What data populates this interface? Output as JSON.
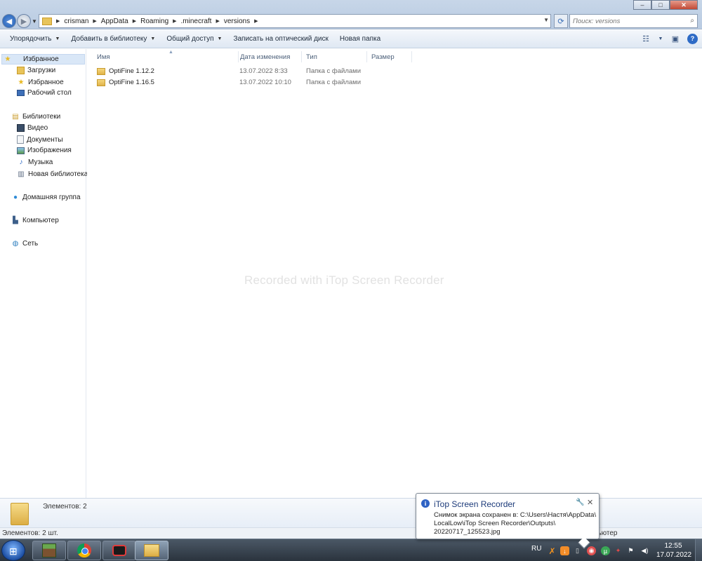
{
  "window": {
    "breadcrumbs": [
      "crisman",
      "AppData",
      "Roaming",
      ".minecraft",
      "versions"
    ],
    "search_placeholder": "Поиск: versions",
    "controls": {
      "minimize": "–",
      "maximize": "□",
      "close": "✕"
    }
  },
  "toolbar": {
    "items": [
      {
        "label": "Упорядочить",
        "has_arrow": true
      },
      {
        "label": "Добавить в библиотеку",
        "has_arrow": true
      },
      {
        "label": "Общий доступ",
        "has_arrow": true
      },
      {
        "label": "Записать на оптический диск",
        "has_arrow": false
      },
      {
        "label": "Новая папка",
        "has_arrow": false
      }
    ],
    "arrow_glyph": "▼"
  },
  "navpane": {
    "favorites": {
      "label": "Избранное",
      "icon": "star-icon"
    },
    "favorite_items": [
      {
        "label": "Загрузки",
        "icon": "downloads-folder-icon"
      },
      {
        "label": "Избранное",
        "icon": "star-icon"
      },
      {
        "label": "Рабочий стол",
        "icon": "desktop-icon"
      }
    ],
    "libraries": {
      "label": "Библиотеки",
      "icon": "libraries-icon"
    },
    "library_items": [
      {
        "label": "Видео",
        "icon": "video-icon"
      },
      {
        "label": "Документы",
        "icon": "documents-icon"
      },
      {
        "label": "Изображения",
        "icon": "pictures-icon"
      },
      {
        "label": "Музыка",
        "icon": "music-icon"
      },
      {
        "label": "Новая библиотека",
        "icon": "library-icon"
      }
    ],
    "homegroup": {
      "label": "Домашняя группа",
      "icon": "homegroup-icon"
    },
    "computer": {
      "label": "Компьютер",
      "icon": "computer-icon"
    },
    "network": {
      "label": "Сеть",
      "icon": "network-icon"
    }
  },
  "filelist": {
    "columns": [
      "Имя",
      "Дата изменения",
      "Тип",
      "Размер"
    ],
    "rows": [
      {
        "name": "OptiFine 1.12.2",
        "date": "13.07.2022 8:33",
        "type": "Папка с файлами",
        "size": ""
      },
      {
        "name": "OptiFine 1.16.5",
        "date": "13.07.2022 10:10",
        "type": "Папка с файлами",
        "size": ""
      }
    ],
    "watermark": "Recorded with iTop Screen Recorder"
  },
  "details": {
    "count": "Элементов: 2"
  },
  "statusbar": {
    "left": "Элементов: 2 шт.",
    "right": "пьютер"
  },
  "taskbar": {
    "apps": [
      "minecraft-app-icon",
      "chrome-app-icon",
      "itop-recorder-app-icon",
      "explorer-app-icon"
    ],
    "language": "RU",
    "time": "12:55",
    "date": "17.07.2022"
  },
  "notification": {
    "title": "iTop Screen Recorder",
    "lines": [
      "Снимок экрана сохранен в: C:\\Users\\Настя\\AppData\\",
      "LocalLow\\iTop Screen Recorder\\Outputs\\",
      "20220717_125523.jpg"
    ]
  },
  "colors": {
    "accent": "#2e62c4",
    "selection": "#d9e7f7",
    "taskbar": "#2a333d",
    "folder": "#e0b34a"
  }
}
